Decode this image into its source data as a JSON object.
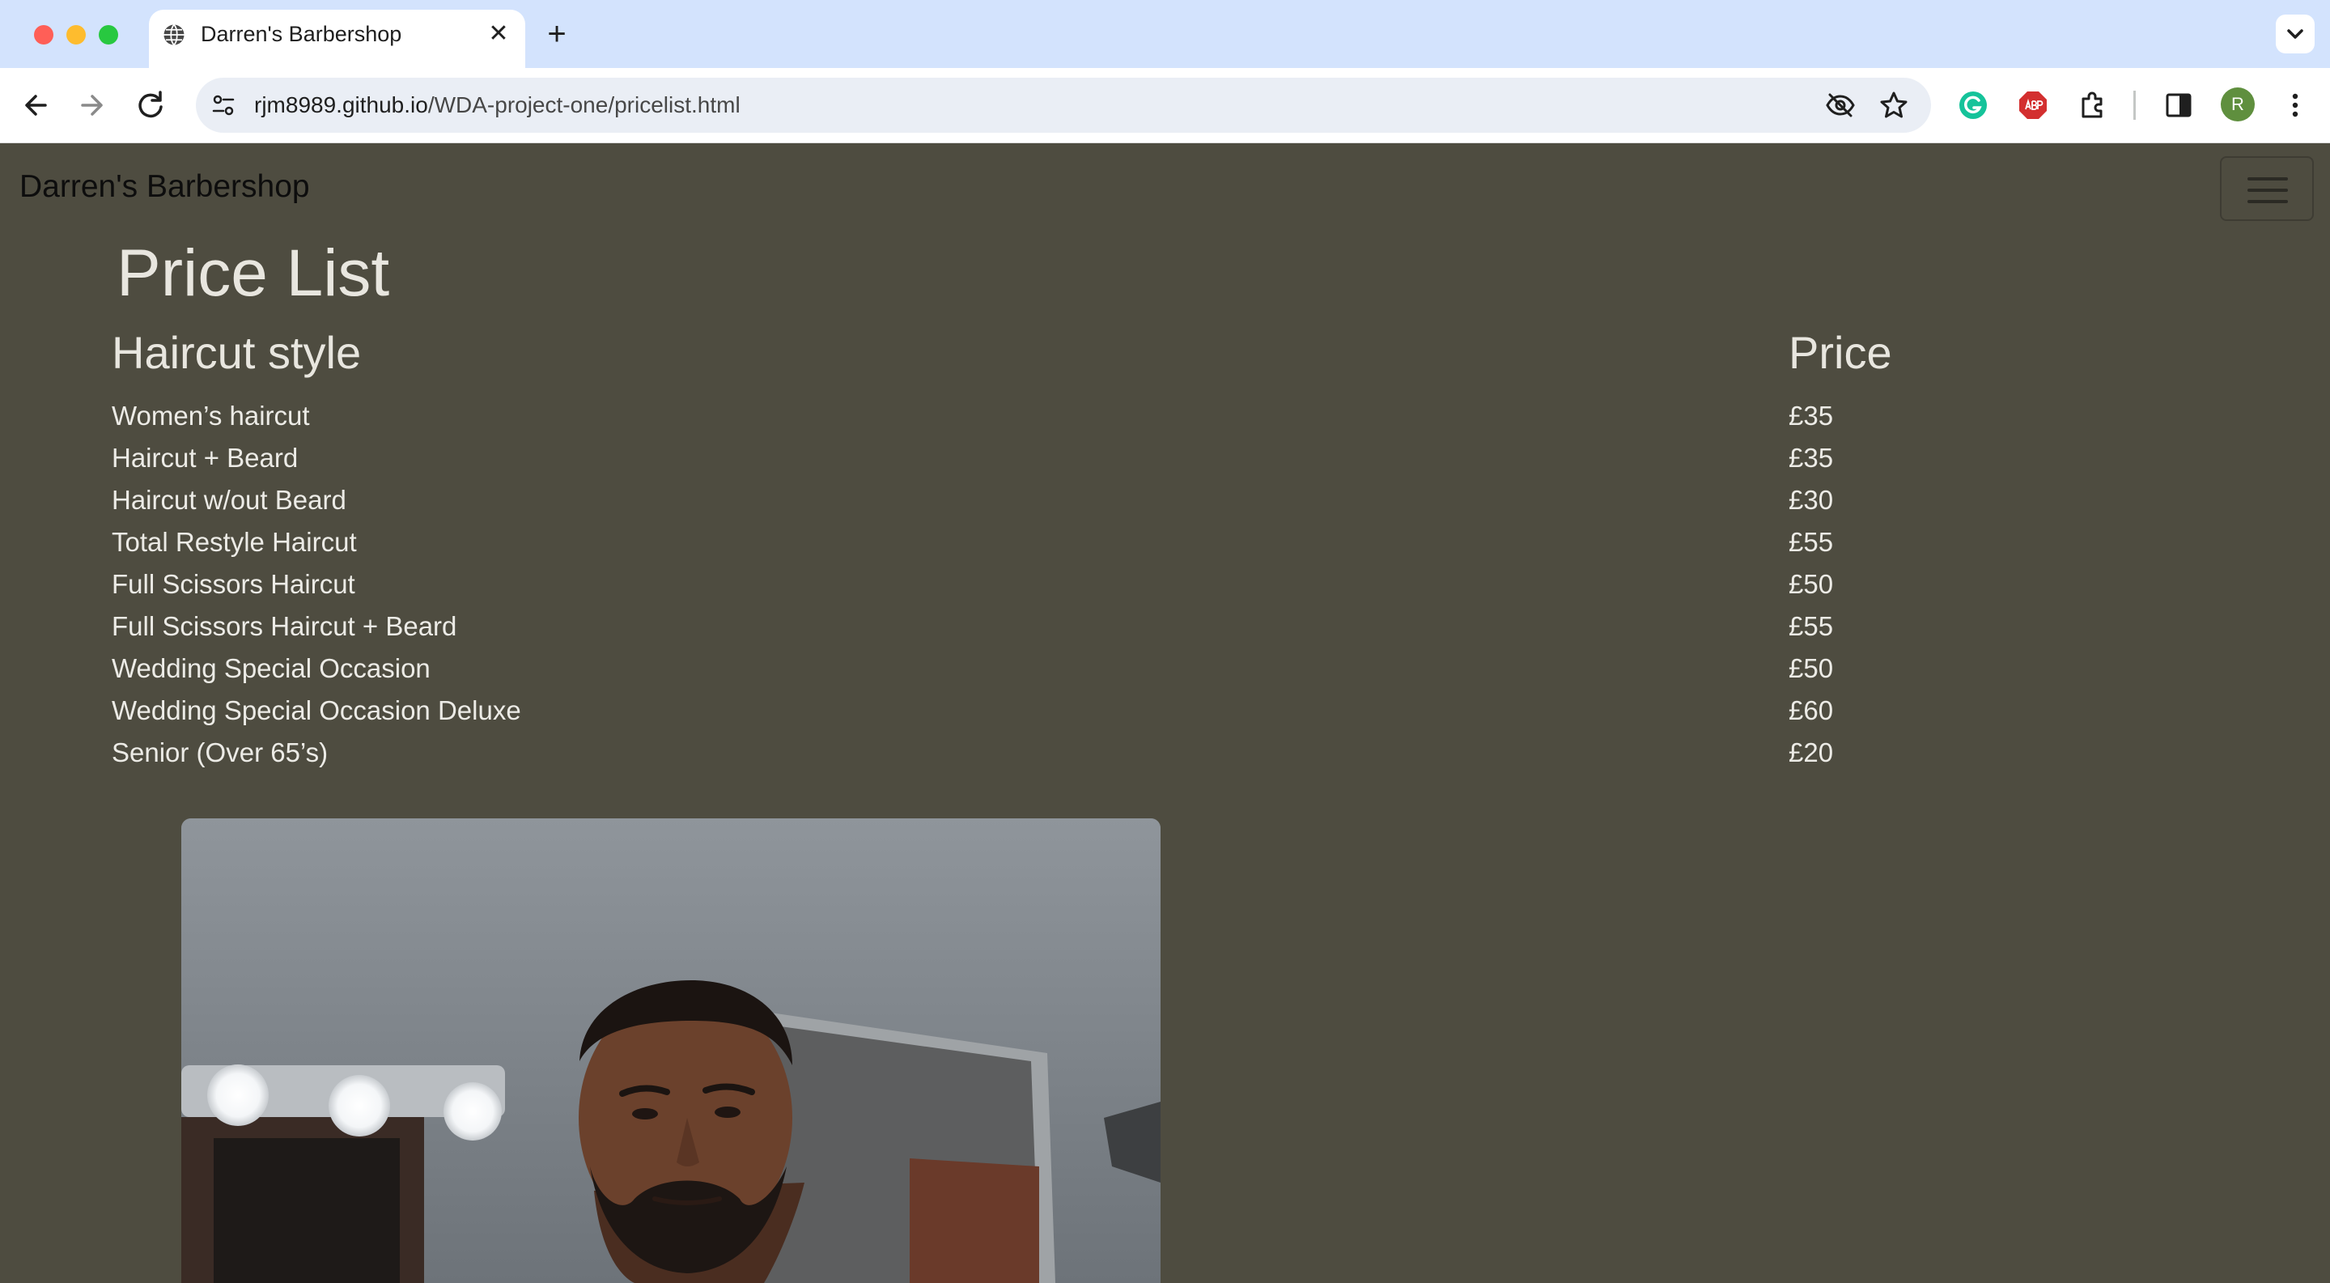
{
  "browser": {
    "tab_title": "Darren's Barbershop",
    "close_tab_glyph": "✕",
    "new_tab_glyph": "+",
    "url_domain": "rjm8989.github.io",
    "url_path": "/WDA-project-one/pricelist.html",
    "avatar_letter": "R",
    "icons": [
      "back-icon",
      "forward-icon",
      "reload-icon",
      "site-info-icon",
      "eye-off-icon",
      "star-icon",
      "grammarly-icon",
      "adblock-icon",
      "extensions-icon",
      "side-panel-icon",
      "menu-icon"
    ]
  },
  "site": {
    "brand": "Darren's Barbershop"
  },
  "pricelist": {
    "title": "Price List",
    "col_style": "Haircut style",
    "col_price": "Price",
    "rows": [
      {
        "style": "Women’s haircut",
        "price": "£35"
      },
      {
        "style": "Haircut + Beard",
        "price": "£35"
      },
      {
        "style": "Haircut w/out Beard",
        "price": "£30"
      },
      {
        "style": "Total Restyle Haircut",
        "price": "£55"
      },
      {
        "style": "Full Scissors Haircut",
        "price": "£50"
      },
      {
        "style": "Full Scissors Haircut + Beard",
        "price": "£55"
      },
      {
        "style": "Wedding Special Occasion",
        "price": "£50"
      },
      {
        "style": "Wedding Special Occasion Deluxe",
        "price": "£60"
      },
      {
        "style": "Senior (Over 65’s)",
        "price": "£20"
      }
    ]
  },
  "colors": {
    "page_bg": "#4e4c40",
    "text_light": "#ecebe6",
    "tab_strip": "#d3e3fd"
  }
}
